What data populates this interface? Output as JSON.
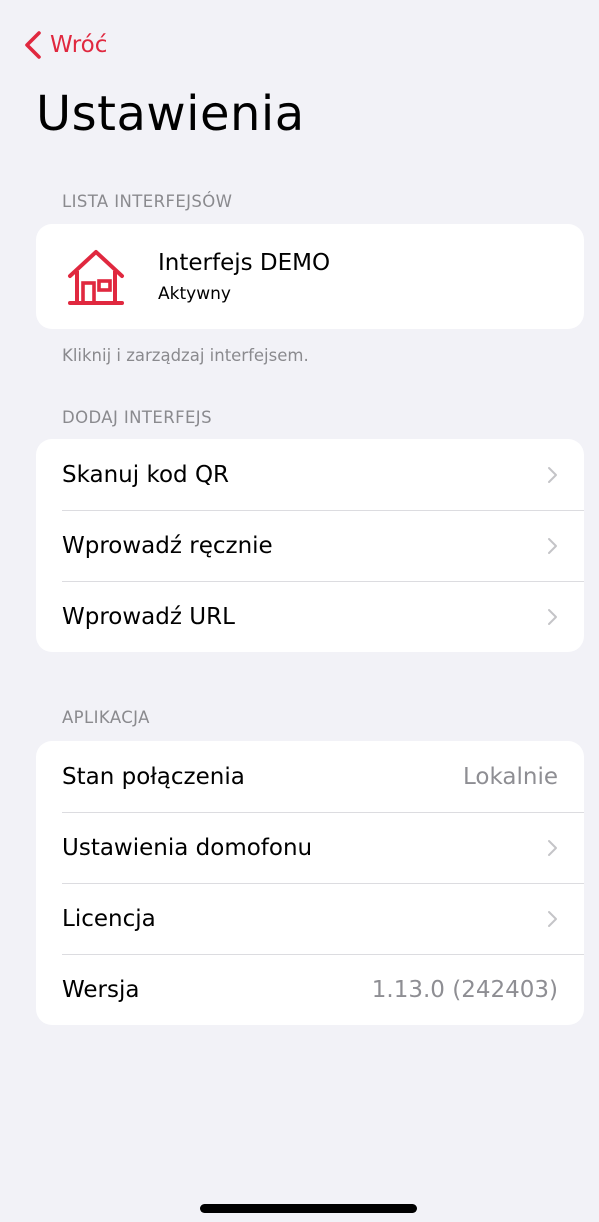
{
  "nav": {
    "back_label": "Wróć"
  },
  "title": "Ustawienia",
  "interfaces_section": {
    "header": "LISTA INTERFEJSÓW",
    "item": {
      "name": "Interfejs DEMO",
      "status": "Aktywny",
      "icon": "house-icon"
    },
    "footer": "Kliknij i zarządzaj interfejsem."
  },
  "add_section": {
    "header": "DODAJ INTERFEJS",
    "rows": [
      {
        "label": "Skanuj kod QR"
      },
      {
        "label": "Wprowadź ręcznie"
      },
      {
        "label": "Wprowadź URL"
      }
    ]
  },
  "app_section": {
    "header": "APLIKACJA",
    "rows": [
      {
        "label": "Stan połączenia",
        "value": "Lokalnie"
      },
      {
        "label": "Ustawienia domofonu"
      },
      {
        "label": "Licencja"
      },
      {
        "label": "Wersja",
        "value": "1.13.0 (242403)"
      }
    ]
  },
  "colors": {
    "accent": "#e0283f",
    "background": "#f2f2f7",
    "secondary_text": "#8e8e93"
  }
}
